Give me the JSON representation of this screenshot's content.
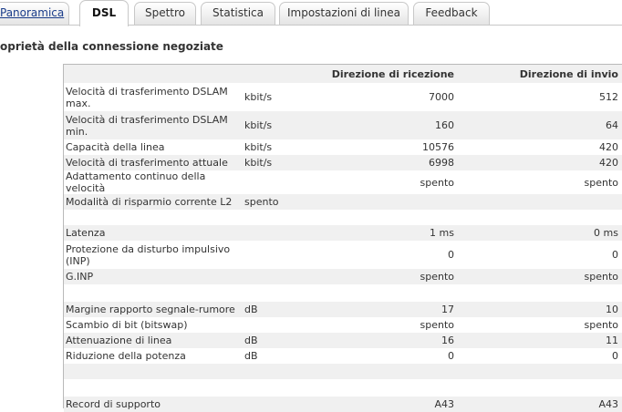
{
  "tabs": [
    {
      "label": "Panoramica"
    },
    {
      "label": "DSL"
    },
    {
      "label": "Spettro"
    },
    {
      "label": "Statistica"
    },
    {
      "label": "Impostazioni di linea"
    },
    {
      "label": "Feedback"
    }
  ],
  "section_title": "oprietà della connessione negoziate",
  "table": {
    "headers": [
      "",
      "",
      "Direzione di ricezione",
      "Direzione di invio"
    ],
    "rows": [
      [
        "Velocità di trasferimento DSLAM max.",
        "kbit/s",
        "7000",
        "512"
      ],
      [
        "Velocità di trasferimento DSLAM min.",
        "kbit/s",
        "160",
        "64"
      ],
      [
        "Capacità della linea",
        "kbit/s",
        "10576",
        "420"
      ],
      [
        "Velocità di trasferimento attuale",
        "kbit/s",
        "6998",
        "420"
      ],
      [
        "Adattamento continuo della velocità",
        "",
        "spento",
        "spento"
      ],
      [
        "Modalità di risparmio corrente L2",
        "spento",
        "",
        ""
      ],
      [
        "",
        "",
        "",
        ""
      ],
      [
        "Latenza",
        "",
        "1 ms",
        "0 ms"
      ],
      [
        "Protezione da disturbo impulsivo (INP)",
        "",
        "0",
        "0"
      ],
      [
        "G.INP",
        "",
        "spento",
        "spento"
      ],
      [
        "",
        "",
        "",
        ""
      ],
      [
        "Margine rapporto segnale-rumore",
        "dB",
        "17",
        "10"
      ],
      [
        "Scambio di bit (bitswap)",
        "",
        "spento",
        "spento"
      ],
      [
        "Attenuazione di linea",
        "dB",
        "16",
        "11"
      ],
      [
        "Riduzione della potenza",
        "dB",
        "0",
        "0"
      ],
      [
        "",
        "",
        "",
        ""
      ],
      [
        "",
        "",
        "",
        ""
      ],
      [
        "Record di supporto",
        "",
        "A43",
        "A43"
      ]
    ]
  }
}
